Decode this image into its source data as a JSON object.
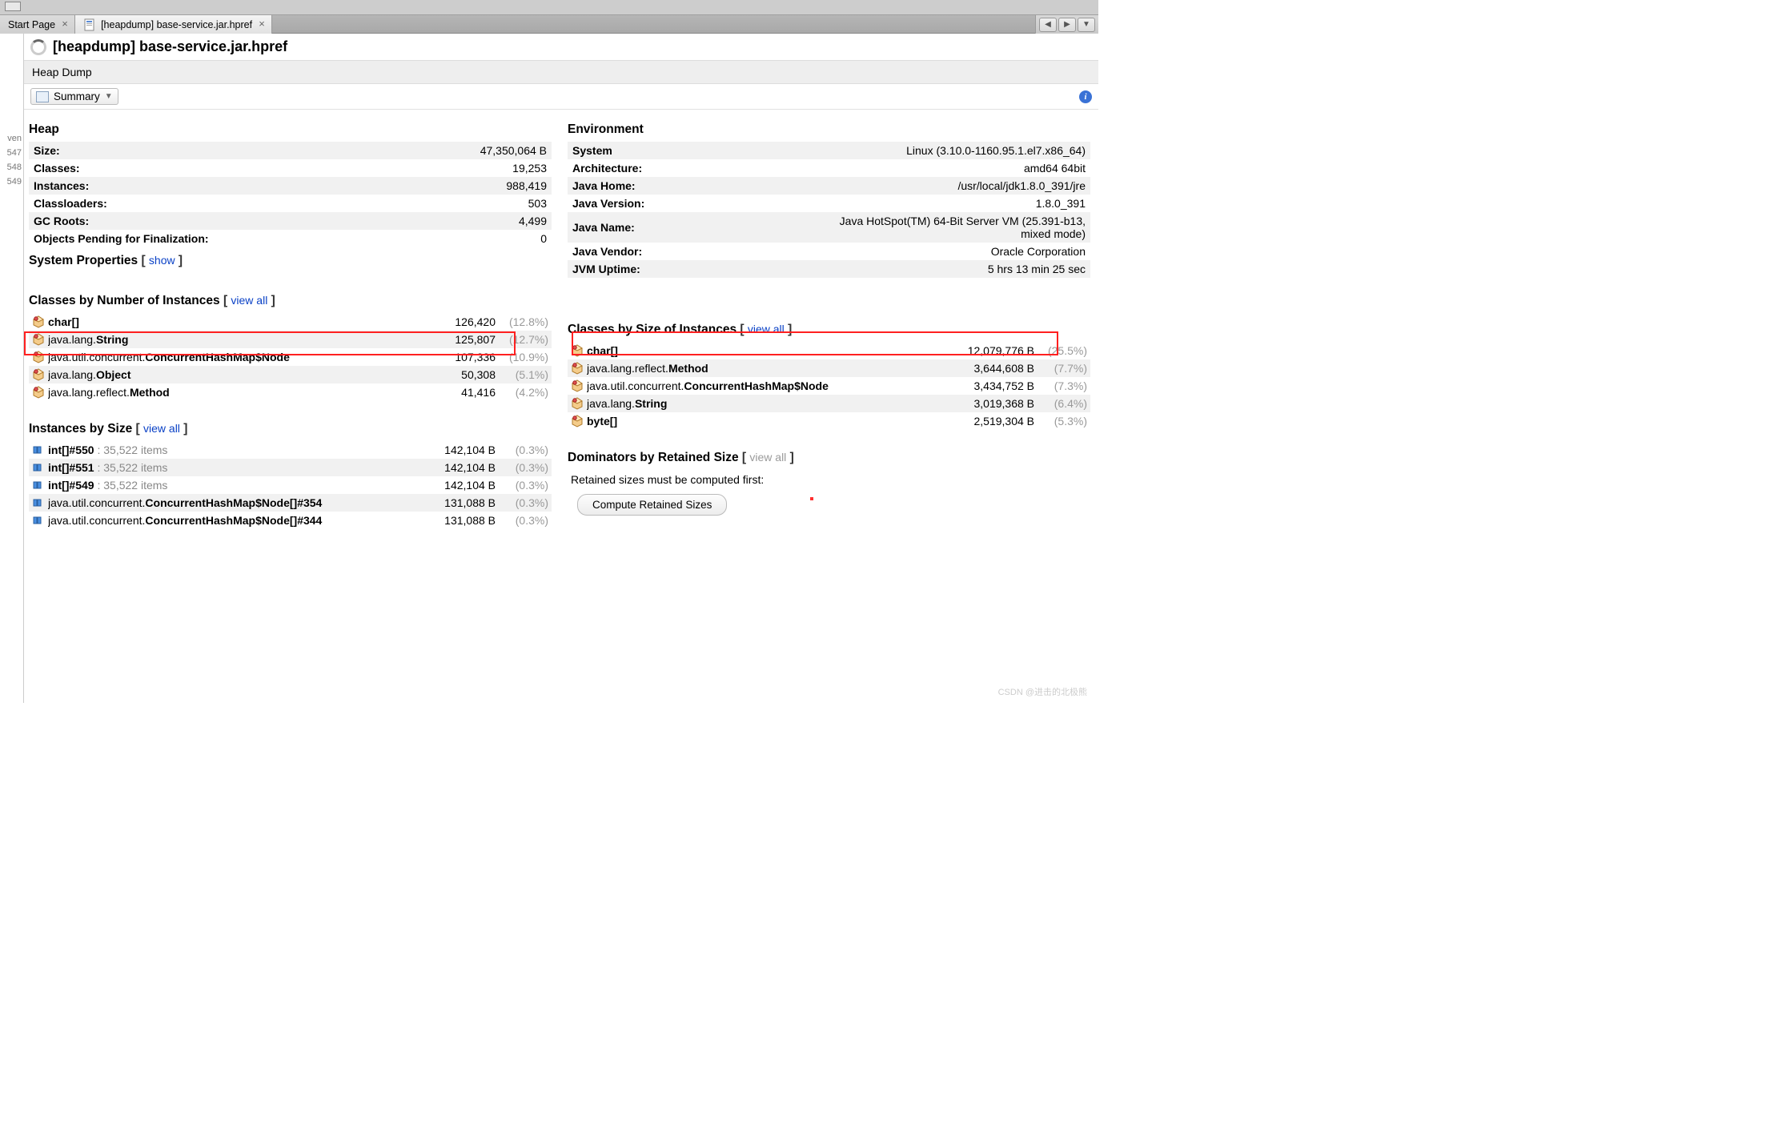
{
  "tabs": {
    "start": "Start Page",
    "active": "[heapdump] base-service.jar.hpref"
  },
  "page_title": "[heapdump] base-service.jar.hpref",
  "section": "Heap Dump",
  "dropdown_label": "Summary",
  "gutter": {
    "a": "ven",
    "b": "547",
    "c": "548",
    "d": "549"
  },
  "heap": {
    "title": "Heap",
    "rows": [
      {
        "k": "Size:",
        "v": "47,350,064 B"
      },
      {
        "k": "Classes:",
        "v": "19,253"
      },
      {
        "k": "Instances:",
        "v": "988,419"
      },
      {
        "k": "Classloaders:",
        "v": "503"
      },
      {
        "k": "GC Roots:",
        "v": "4,499"
      },
      {
        "k": "Objects Pending for Finalization:",
        "v": "0"
      }
    ]
  },
  "env": {
    "title": "Environment",
    "rows": [
      {
        "k": "System",
        "v": "Linux (3.10.0-1160.95.1.el7.x86_64)"
      },
      {
        "k": "Architecture:",
        "v": "amd64 64bit"
      },
      {
        "k": "Java Home:",
        "v": "/usr/local/jdk1.8.0_391/jre"
      },
      {
        "k": "Java Version:",
        "v": "1.8.0_391"
      },
      {
        "k": "Java Name:",
        "v": "Java HotSpot(TM) 64-Bit Server VM (25.391-b13, mixed mode)"
      },
      {
        "k": "Java Vendor:",
        "v": "Oracle Corporation"
      },
      {
        "k": "JVM Uptime:",
        "v": "5 hrs 13 min 25 sec"
      }
    ]
  },
  "sysprops": {
    "title": "System Properties",
    "link": "show"
  },
  "by_count": {
    "title": "Classes by Number of Instances",
    "link": "view all",
    "rows": [
      {
        "pre": "",
        "bold": "char[]",
        "v": "126,420",
        "pct": "(12.8%)"
      },
      {
        "pre": "java.lang.",
        "bold": "String",
        "v": "125,807",
        "pct": "(12.7%)"
      },
      {
        "pre": "java.util.concurrent.",
        "bold": "ConcurrentHashMap$Node",
        "v": "107,336",
        "pct": "(10.9%)"
      },
      {
        "pre": "java.lang.",
        "bold": "Object",
        "v": "50,308",
        "pct": "(5.1%)"
      },
      {
        "pre": "java.lang.reflect.",
        "bold": "Method",
        "v": "41,416",
        "pct": "(4.2%)"
      }
    ]
  },
  "by_size": {
    "title": "Classes by Size of Instances",
    "link": "view all",
    "rows": [
      {
        "pre": "",
        "bold": "char[]",
        "v": "12,079,776 B",
        "pct": "(25.5%)"
      },
      {
        "pre": "java.lang.reflect.",
        "bold": "Method",
        "v": "3,644,608 B",
        "pct": "(7.7%)"
      },
      {
        "pre": "java.util.concurrent.",
        "bold": "ConcurrentHashMap$Node",
        "v": "3,434,752 B",
        "pct": "(7.3%)"
      },
      {
        "pre": "java.lang.",
        "bold": "String",
        "v": "3,019,368 B",
        "pct": "(6.4%)"
      },
      {
        "pre": "",
        "bold": "byte[]",
        "v": "2,519,304 B",
        "pct": "(5.3%)"
      }
    ]
  },
  "inst_size": {
    "title": "Instances by Size",
    "link": "view all",
    "rows": [
      {
        "nm": "int[]#550",
        "sub": " : 35,522 items",
        "v": "142,104 B",
        "pct": "(0.3%)"
      },
      {
        "nm": "int[]#551",
        "sub": " : 35,522 items",
        "v": "142,104 B",
        "pct": "(0.3%)"
      },
      {
        "nm": "int[]#549",
        "sub": " : 35,522 items",
        "v": "142,104 B",
        "pct": "(0.3%)"
      },
      {
        "nm": "java.util.concurrent.",
        "bold": "ConcurrentHashMap$Node[]#354",
        "v": "131,088 B",
        "pct": "(0.3%)"
      },
      {
        "nm": "java.util.concurrent.",
        "bold": "ConcurrentHashMap$Node[]#344",
        "v": "131,088 B",
        "pct": "(0.3%)"
      }
    ]
  },
  "dominators": {
    "title": "Dominators by Retained Size",
    "link": "view all",
    "msg": "Retained sizes must be computed first:",
    "btn": "Compute Retained Sizes"
  },
  "watermark": "CSDN @进击的北极熊"
}
